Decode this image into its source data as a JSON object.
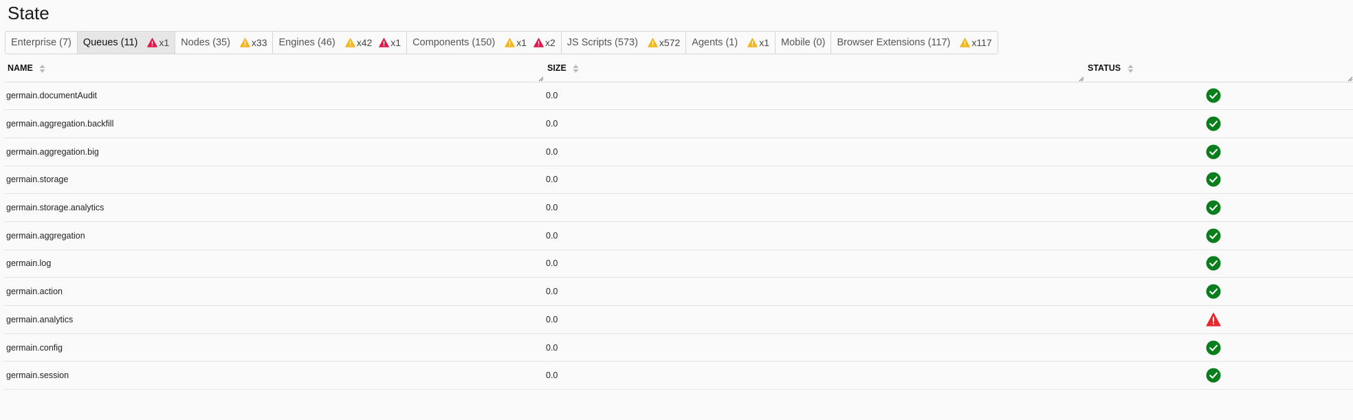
{
  "page": {
    "title": "State"
  },
  "colors": {
    "accent_ok": "#0a7d1c",
    "warning_yellow": "#f3b61f",
    "error_red": "#e0194b",
    "status_error_red": "#e8282e"
  },
  "tabs": [
    {
      "label": "Enterprise (7)",
      "active": false,
      "badges": []
    },
    {
      "label": "Queues (11)",
      "active": true,
      "badges": [
        {
          "icon": "error-triangle-icon",
          "count": "x1"
        }
      ]
    },
    {
      "label": "Nodes (35)",
      "active": false,
      "badges": [
        {
          "icon": "warning-triangle-icon",
          "count": "x33"
        }
      ]
    },
    {
      "label": "Engines (46)",
      "active": false,
      "badges": [
        {
          "icon": "warning-triangle-icon",
          "count": "x42"
        },
        {
          "icon": "error-triangle-icon",
          "count": "x1"
        }
      ]
    },
    {
      "label": "Components (150)",
      "active": false,
      "badges": [
        {
          "icon": "warning-triangle-icon",
          "count": "x1"
        },
        {
          "icon": "error-triangle-icon",
          "count": "x2"
        }
      ]
    },
    {
      "label": "JS Scripts (573)",
      "active": false,
      "badges": [
        {
          "icon": "warning-triangle-icon",
          "count": "x572"
        }
      ]
    },
    {
      "label": "Agents (1)",
      "active": false,
      "badges": [
        {
          "icon": "warning-triangle-icon",
          "count": "x1"
        }
      ]
    },
    {
      "label": "Mobile (0)",
      "active": false,
      "badges": []
    },
    {
      "label": "Browser Extensions (117)",
      "active": false,
      "badges": [
        {
          "icon": "warning-triangle-icon",
          "count": "x117"
        }
      ]
    }
  ],
  "table": {
    "columns": {
      "name": "NAME",
      "size": "SIZE",
      "status": "STATUS"
    },
    "rows": [
      {
        "name": "germain.documentAudit",
        "size": "0.0",
        "status": "ok"
      },
      {
        "name": "germain.aggregation.backfill",
        "size": "0.0",
        "status": "ok"
      },
      {
        "name": "germain.aggregation.big",
        "size": "0.0",
        "status": "ok"
      },
      {
        "name": "germain.storage",
        "size": "0.0",
        "status": "ok"
      },
      {
        "name": "germain.storage.analytics",
        "size": "0.0",
        "status": "ok"
      },
      {
        "name": "germain.aggregation",
        "size": "0.0",
        "status": "ok"
      },
      {
        "name": "germain.log",
        "size": "0.0",
        "status": "ok"
      },
      {
        "name": "germain.action",
        "size": "0.0",
        "status": "ok"
      },
      {
        "name": "germain.analytics",
        "size": "0.0",
        "status": "error"
      },
      {
        "name": "germain.config",
        "size": "0.0",
        "status": "ok"
      },
      {
        "name": "germain.session",
        "size": "0.0",
        "status": "ok"
      }
    ]
  }
}
